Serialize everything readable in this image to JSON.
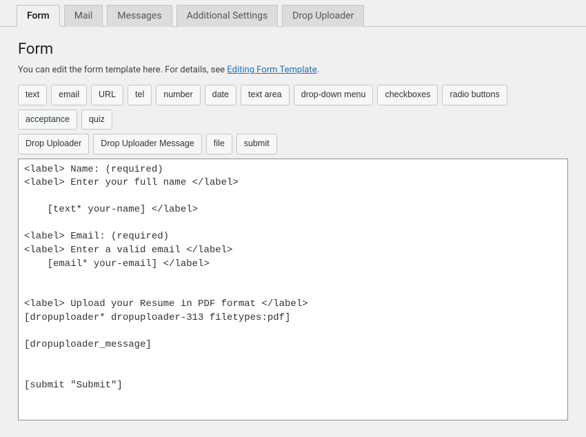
{
  "tabs": [
    {
      "label": "Form",
      "active": true
    },
    {
      "label": "Mail",
      "active": false
    },
    {
      "label": "Messages",
      "active": false
    },
    {
      "label": "Additional Settings",
      "active": false
    },
    {
      "label": "Drop Uploader",
      "active": false
    }
  ],
  "panel": {
    "title": "Form",
    "desc_prefix": "You can edit the form template here. For details, see ",
    "desc_link": "Editing Form Template",
    "desc_suffix": "."
  },
  "tag_buttons_row1": [
    "text",
    "email",
    "URL",
    "tel",
    "number",
    "date",
    "text area",
    "drop-down menu",
    "checkboxes",
    "radio buttons",
    "acceptance",
    "quiz"
  ],
  "tag_buttons_row2": [
    "Drop Uploader",
    "Drop Uploader Message",
    "file",
    "submit"
  ],
  "form_code": "<label> Name: (required)\n<label> Enter your full name </label>\n\n    [text* your-name] </label>\n\n<label> Email: (required)\n<label> Enter a valid email </label>\n    [email* your-email] </label>\n\n\n<label> Upload your Resume in PDF format </label>\n[dropuploader* dropuploader-313 filetypes:pdf]\n\n[dropuploader_message]\n\n\n[submit \"Submit\"]"
}
